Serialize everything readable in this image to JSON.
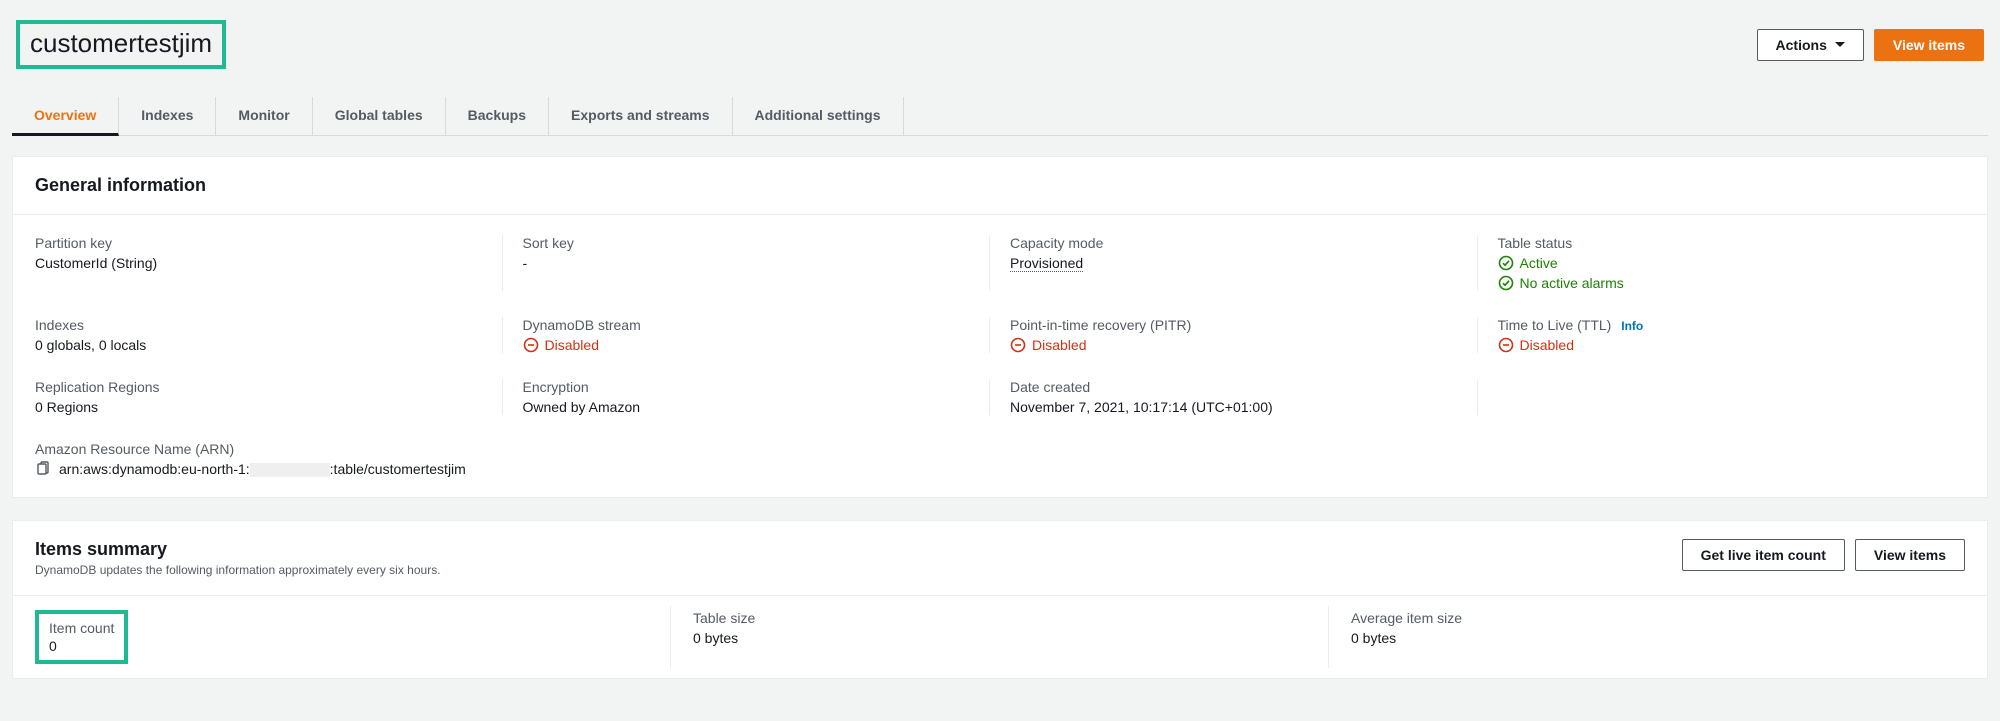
{
  "page": {
    "title": "customertestjim",
    "actions_label": "Actions",
    "view_items_label": "View items"
  },
  "tabs": [
    "Overview",
    "Indexes",
    "Monitor",
    "Global tables",
    "Backups",
    "Exports and streams",
    "Additional settings"
  ],
  "general": {
    "heading": "General information",
    "partition_key": {
      "label": "Partition key",
      "value": "CustomerId (String)"
    },
    "sort_key": {
      "label": "Sort key",
      "value": "-"
    },
    "capacity": {
      "label": "Capacity mode",
      "value": "Provisioned"
    },
    "status": {
      "label": "Table status",
      "value": "Active",
      "alarms": "No active alarms"
    },
    "indexes": {
      "label": "Indexes",
      "value": "0 globals, 0 locals"
    },
    "stream": {
      "label": "DynamoDB stream",
      "value": "Disabled"
    },
    "pitr": {
      "label": "Point-in-time recovery (PITR)",
      "value": "Disabled"
    },
    "ttl": {
      "label": "Time to Live (TTL)",
      "info": "Info",
      "value": "Disabled"
    },
    "replication": {
      "label": "Replication Regions",
      "value": "0 Regions"
    },
    "encryption": {
      "label": "Encryption",
      "value": "Owned by Amazon"
    },
    "created": {
      "label": "Date created",
      "value": "November 7, 2021, 10:17:14 (UTC+01:00)"
    },
    "arn": {
      "label": "Amazon Resource Name (ARN)",
      "prefix": "arn:aws:dynamodb:eu-north-1:",
      "suffix": ":table/customertestjim"
    }
  },
  "items": {
    "heading": "Items summary",
    "subheading": "DynamoDB updates the following information approximately every six hours.",
    "live_count_label": "Get live item count",
    "view_items_label": "View items",
    "item_count": {
      "label": "Item count",
      "value": "0"
    },
    "table_size": {
      "label": "Table size",
      "value": "0 bytes"
    },
    "avg_size": {
      "label": "Average item size",
      "value": "0 bytes"
    }
  }
}
